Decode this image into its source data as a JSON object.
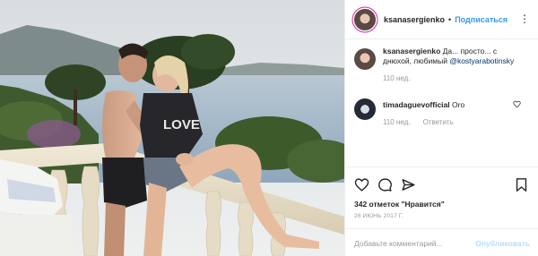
{
  "post": {
    "author": "ksanasergienko",
    "separator": "•",
    "follow_label": "Подписаться",
    "more_label": "⋮"
  },
  "caption": {
    "username": "ksanasergienko",
    "text": " Да... просто... с днюхой, любимый ",
    "mention": "@kostyarabotinsky",
    "age": "110 нед."
  },
  "comments": [
    {
      "username": "timadaguevofficial",
      "text": " Oro",
      "age": "110 нед.",
      "reply_label": "Ответить"
    }
  ],
  "likes": "342 отметок \"Нравится\"",
  "date": "26 ИЮНЬ 2017 Г.",
  "add_comment": {
    "placeholder": "Добавьте комментарий...",
    "publish_label": "Опубликовать"
  },
  "photo": {
    "shirt_text": "LOVE"
  },
  "colors": {
    "link": "#3897f0",
    "publish_disabled": "#b2dffc",
    "muted": "#999999",
    "text": "#262626"
  },
  "icons": [
    "heart-icon",
    "comment-icon",
    "share-icon",
    "bookmark-icon",
    "like-comment-icon",
    "more-options-icon"
  ]
}
